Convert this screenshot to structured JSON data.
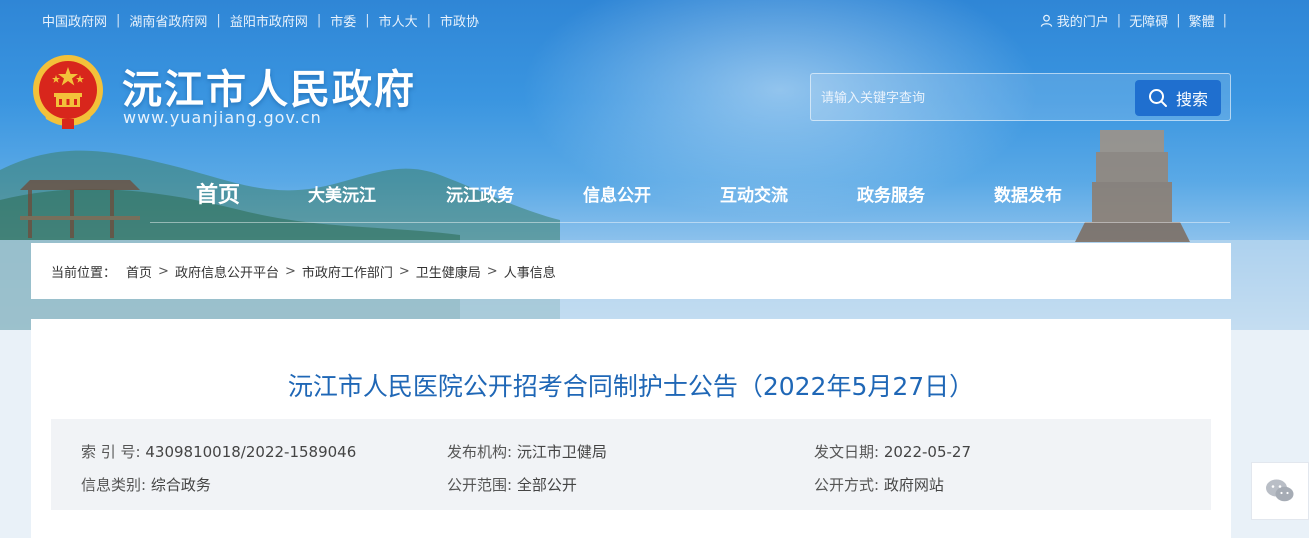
{
  "topbar": {
    "links": [
      "中国政府网",
      "湖南省政府网",
      "益阳市政府网",
      "市委",
      "市人大",
      "市政协"
    ],
    "my_portal": "我的门户",
    "accessibility": "无障碍",
    "traditional": "繁體"
  },
  "header": {
    "title": "沅江市人民政府",
    "url": "www.yuanjiang.gov.cn"
  },
  "search": {
    "placeholder": "请输入关键字查询",
    "button_label": "搜索"
  },
  "nav": {
    "items": [
      "首页",
      "大美沅江",
      "沅江政务",
      "信息公开",
      "互动交流",
      "政务服务",
      "数据发布"
    ]
  },
  "breadcrumb": {
    "label": "当前位置：",
    "items": [
      "首页",
      "政府信息公开平台",
      "市政府工作部门",
      "卫生健康局",
      "人事信息"
    ]
  },
  "article": {
    "title": "沅江市人民医院公开招考合同制护士公告（2022年5月27日）",
    "meta": {
      "index_key": "索 引 号:",
      "index_val": "4309810018/2022-1589046",
      "org_key": "发布机构:",
      "org_val": "沅江市卫健局",
      "date_key": "发文日期:",
      "date_val": "2022-05-27",
      "category_key": "信息类别:",
      "category_val": "综合政务",
      "scope_key": "公开范围:",
      "scope_val": "全部公开",
      "method_key": "公开方式:",
      "method_val": "政府网站"
    }
  },
  "colors": {
    "title_blue": "#1f67b6",
    "search_button": "#1f6fcf",
    "emblem_red": "#d8261c",
    "emblem_gold": "#f3c13a"
  }
}
